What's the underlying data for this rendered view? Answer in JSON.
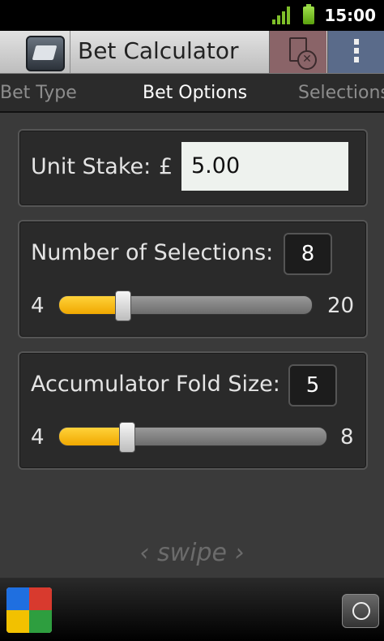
{
  "status": {
    "time": "15:00"
  },
  "header": {
    "title": "Bet Calculator",
    "icons": [
      "app-logo-icon",
      "clear-selections-icon",
      "overflow-menu-icon"
    ]
  },
  "tabs": [
    {
      "label": "Bet Type",
      "active": false
    },
    {
      "label": "Bet Options",
      "active": true
    },
    {
      "label": "Selections",
      "active": false
    }
  ],
  "unit_stake": {
    "label": "Unit Stake:",
    "currency": "£",
    "value": "5.00"
  },
  "selections": {
    "label": "Number of Selections:",
    "value": "8",
    "min": "4",
    "max": "20",
    "level": 0.25
  },
  "fold_size": {
    "label": "Accumulator Fold Size:",
    "value": "5",
    "min": "4",
    "max": "8",
    "level": 0.25
  },
  "swipe_hint": "‹ swipe ›",
  "bottom": {
    "icons": [
      "google-search-icon",
      "globe-icon"
    ]
  },
  "colors": {
    "accent": "#f5b800",
    "background": "#3a3a3a"
  }
}
